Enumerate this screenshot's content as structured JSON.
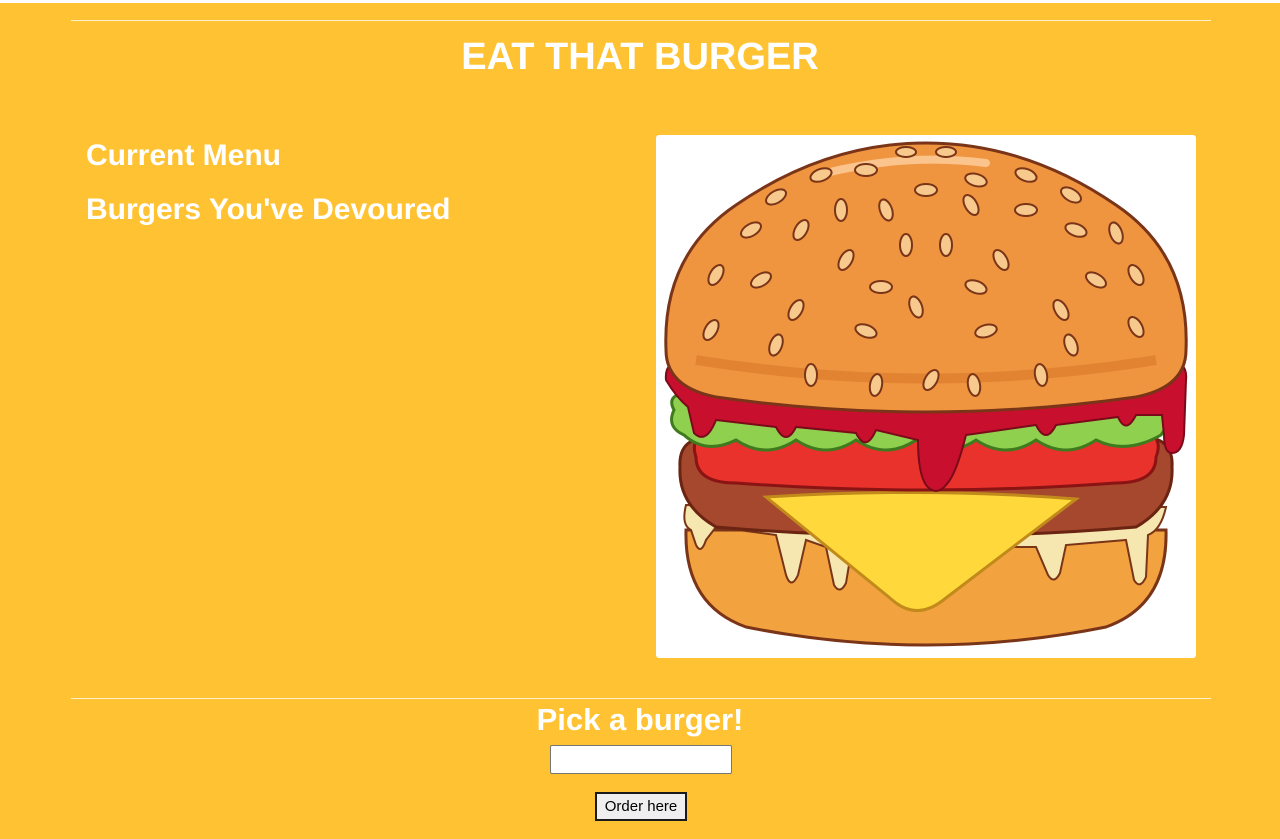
{
  "header": {
    "title": "EAT THAT BURGER"
  },
  "sections": {
    "current_menu": "Current Menu",
    "devoured": "Burgers You've Devoured"
  },
  "hero_image": {
    "icon": "burger-illustration"
  },
  "order_form": {
    "label": "Pick a burger!",
    "input_value": "",
    "button_label": "Order here"
  },
  "colors": {
    "background": "#ffc233",
    "text": "#ffffff",
    "bun": "#ef9540",
    "bun_outline": "#7a3418",
    "lettuce": "#8fd14f",
    "tomato": "#e8322b",
    "patty": "#a5482e",
    "cheese": "#ffd93b",
    "ketchup": "#c8102e"
  }
}
